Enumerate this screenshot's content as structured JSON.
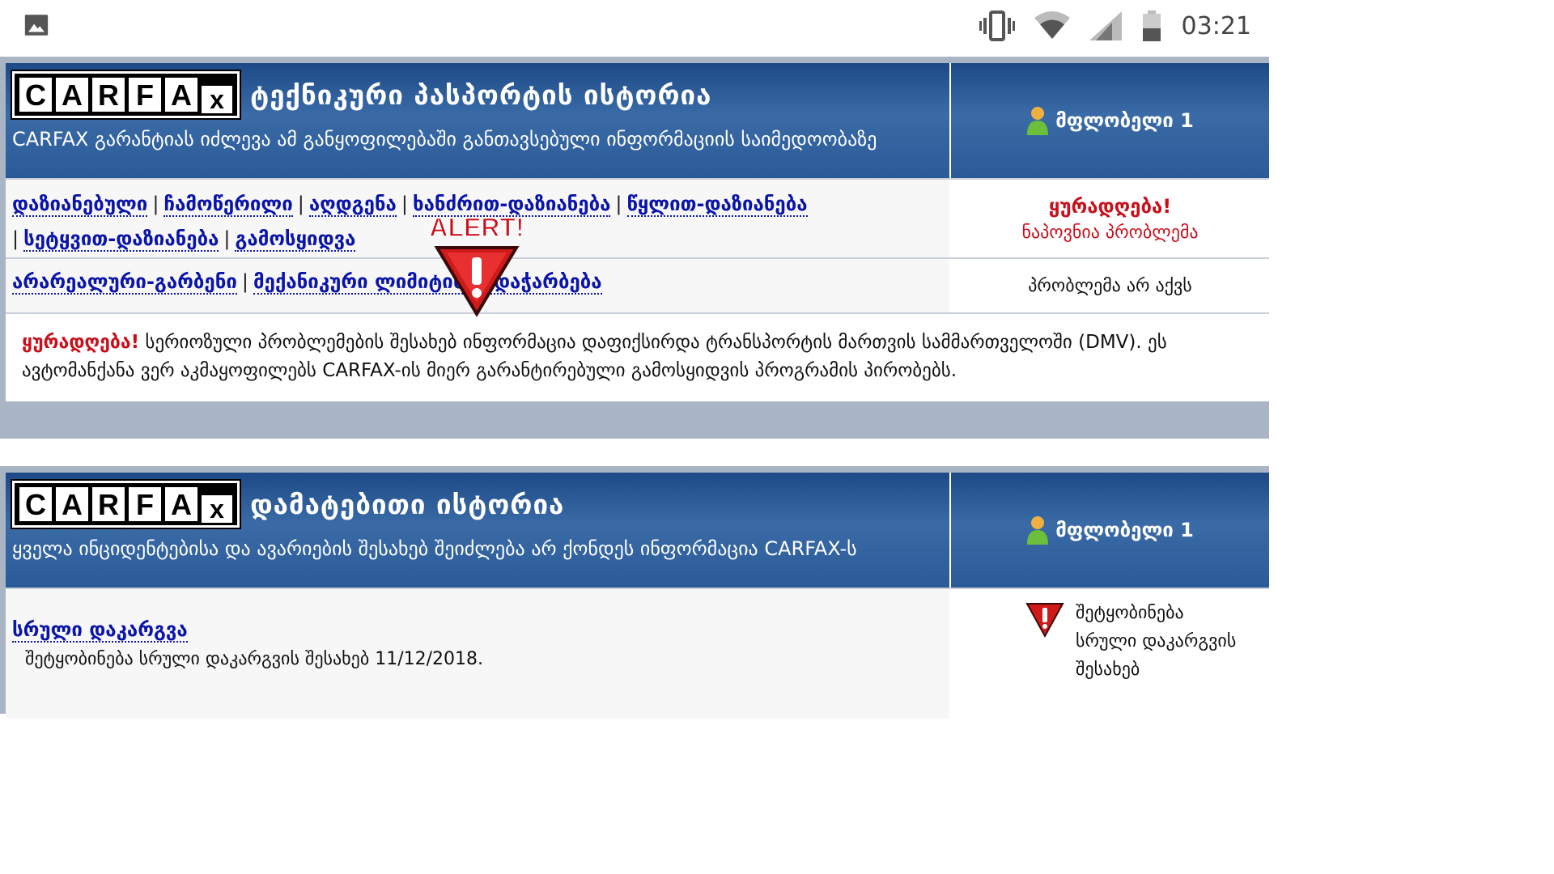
{
  "statusbar": {
    "time": "03:21",
    "left_icon": "image-icon",
    "right_icons": [
      "vibrate-icon",
      "wifi-icon",
      "signal-icon",
      "battery-icon"
    ]
  },
  "section1": {
    "logo_letters": [
      "C",
      "A",
      "R",
      "F",
      "A",
      "x"
    ],
    "title": "ტექნიკური პასპორტის ისტორია",
    "subtitle": "CARFAX გარანტიას იძლევა ამ განყოფილებაში განთავსებული ინფორმაციის საიმედოობაზე",
    "owner_label": "მფლობელი 1",
    "row1": {
      "links": [
        "დაზიანებული",
        "ჩამოწერილი",
        "აღდგენა",
        "ხანძრით-დაზიანება",
        "წყლით-დაზიანება",
        "სეტყვით-დაზიანება",
        "გამოსყიდვა"
      ],
      "separator": "|",
      "side_title": "ყურადღება!",
      "side_sub": "ნაპოვნია პრობლემა"
    },
    "row2": {
      "links": [
        "არარეალური-გარბენი",
        "მექანიკური ლიმიტის გადაჭარბება"
      ],
      "side_text": "პრობლემა არ აქვს"
    },
    "alert_badge": {
      "text": "ALERT!",
      "icon": "alert-triangle-icon"
    },
    "alert_note": {
      "lead": "ყურადღება!",
      "body": "სერიოზული პრობლემების შესახებ ინფორმაცია დაფიქსირდა ტრანსპორტის მართვის სამმართველოში (DMV). ეს ავტომანქანა ვერ აკმაყოფილებს CARFAX-ის მიერ გარანტირებული გამოსყიდვის პროგრამის პირობებს."
    }
  },
  "section2": {
    "logo_letters": [
      "C",
      "A",
      "R",
      "F",
      "A",
      "x"
    ],
    "title": "დამატებითი ისტორია",
    "subtitle": "ყველა ინციდენტებისა და ავარიების შესახებ შეიძლება არ ქონდეს ინფორმაცია CARFAX-ს",
    "owner_label": "მფლობელი 1",
    "loss": {
      "link": "სრული დაკარგვა",
      "desc": "შეტყობინება სრული დაკარგვის შესახებ 11/12/2018.",
      "side_text": "შეტყობინება სრული დაკარგვის შესახებ"
    }
  },
  "colors": {
    "header_blue": "#2a5a98",
    "link_blue": "#0a14a8",
    "alert_red": "#c8101c",
    "frame_gray": "#a9b5c4"
  }
}
